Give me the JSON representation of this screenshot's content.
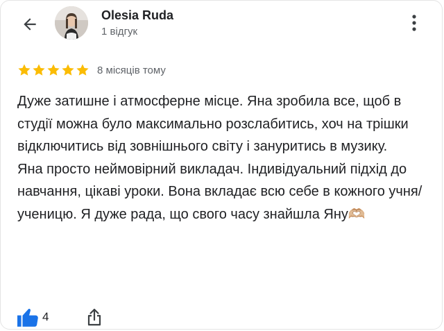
{
  "header": {
    "back_icon": "arrow-left-icon",
    "user_name": "Olesia Ruda",
    "review_count": "1 відгук",
    "more_icon": "more-vert-icon"
  },
  "review": {
    "rating": 5,
    "rating_max": 5,
    "star_color": "#fbbc04",
    "time_ago": "8 місяців тому",
    "text": "Дуже затишне і атмосферне місце. Яна зробила все, щоб в студії можна було максимально розслабитись, хоч на трішки відключитись від зовнішнього світу і зануритись в музику.\nЯна просто неймовірний викладач. Індивідуальний підхід до навчання, цікаві уроки. Вона вкладає всю себе в кожного учня/ученицю. Я дуже рада, що свого часу знайшла Яну🫶🏼"
  },
  "actions": {
    "like_icon": "thumbs-up-icon",
    "like_color": "#1a73e8",
    "like_count": "4",
    "share_icon": "share-icon"
  }
}
